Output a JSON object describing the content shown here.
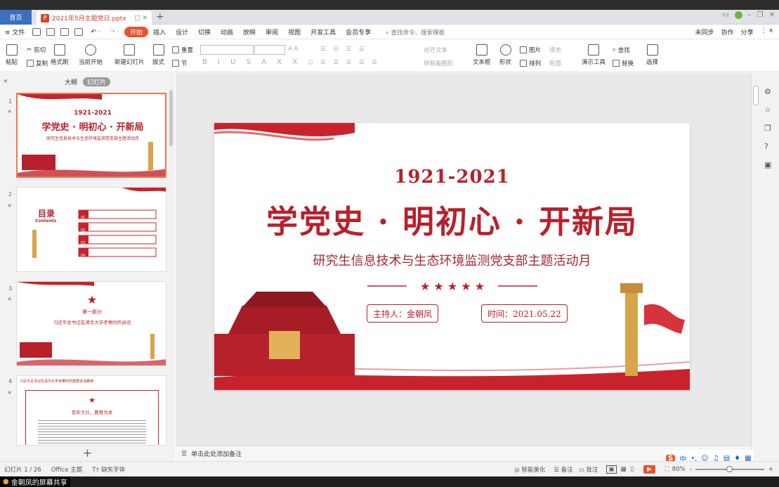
{
  "tabs": {
    "home": "首页",
    "doc": "2021年5月主题党日.pptx"
  },
  "menu": {
    "file": "文件",
    "items": [
      "开始",
      "插入",
      "设计",
      "切换",
      "动画",
      "放映",
      "审阅",
      "视图",
      "开发工具",
      "会员专享"
    ],
    "search": "查找命令、搜索模板",
    "right": [
      "未同步",
      "协作",
      "分享"
    ]
  },
  "ribbon": {
    "paste": "粘贴",
    "cut": "剪切",
    "copy": "复制",
    "format_painter": "格式刷",
    "from_current": "当前开始",
    "new_slide": "新建幻灯片",
    "layout": "版式",
    "section": "节",
    "reset": "重置",
    "para_align": "对齐文本",
    "smartart": "转智能图形",
    "textbox": "文本框",
    "shape": "形状",
    "picture": "图片",
    "arrange": "排列",
    "fill": "填充",
    "outline": "轮廓",
    "present_tools": "演示工具",
    "find": "查找",
    "replace": "替换",
    "select": "选择"
  },
  "pane": {
    "outline": "大纲",
    "slides": "幻灯片"
  },
  "thumbs": [
    {
      "num": "1",
      "year": "1921-2021",
      "title": "学党史 · 明初心 · 开新局",
      "sub": "研究生信息技术与生态环境监测党支部主题活动月"
    },
    {
      "num": "2",
      "title": "目录",
      "en": "Contents",
      "items": [
        "01",
        "02",
        "03",
        "04"
      ]
    },
    {
      "num": "3",
      "part": "第一部分",
      "text": "习近平总书记在清华大学考察时的讲话"
    },
    {
      "num": "4",
      "header": "习近平总书记在清华大学考察时的重要讲话精神",
      "title": "百年大计，教育为本"
    }
  ],
  "slide": {
    "year": "1921-2021",
    "title": "学党史 · 明初心 · 开新局",
    "subtitle": "研究生信息技术与生态环境监测党支部主题活动月",
    "host": "主持人：金朝凤",
    "time": "时间：2021.05.22"
  },
  "notes": "单击此处添加备注",
  "status": {
    "slide": "幻灯片 1 / 26",
    "theme": "Office 主题",
    "font": "缺失字体",
    "beautify": "智能美化",
    "notes": "备注",
    "comments": "批注",
    "zoom": "80%"
  },
  "share": "金朝凤的屏幕共享",
  "ime": {
    "lang": "中"
  },
  "colors": {
    "accent": "#e8522e",
    "red": "#b8202c"
  }
}
